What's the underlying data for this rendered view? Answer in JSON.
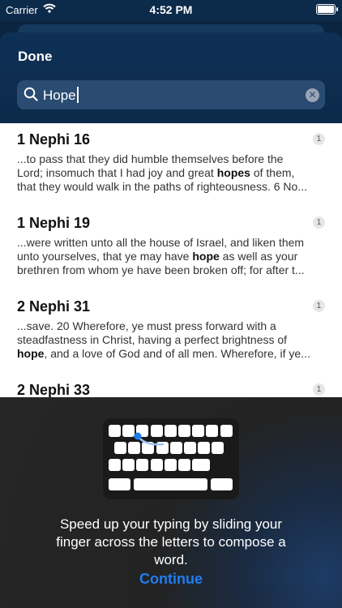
{
  "status_bar": {
    "carrier": "Carrier",
    "time": "4:52 PM"
  },
  "header": {
    "done_label": "Done"
  },
  "search": {
    "value": "Hope"
  },
  "results": [
    {
      "title": "1 Nephi 16",
      "count": "1",
      "lines": [
        [
          {
            "t": "...to pass that they did humble themselves before the"
          }
        ],
        [
          {
            "t": "Lord; insomuch that I had joy and great "
          },
          {
            "t": "hopes",
            "b": true
          },
          {
            "t": " of them,"
          }
        ],
        [
          {
            "t": "that they would walk in the paths of righteousness. 6 No..."
          }
        ]
      ]
    },
    {
      "title": "1 Nephi 19",
      "count": "1",
      "lines": [
        [
          {
            "t": "...were written unto all the house of Israel, and liken them"
          }
        ],
        [
          {
            "t": "unto yourselves, that ye may have "
          },
          {
            "t": "hope",
            "b": true
          },
          {
            "t": " as well as your"
          }
        ],
        [
          {
            "t": "brethren from whom ye have been broken off; for after t..."
          }
        ]
      ]
    },
    {
      "title": "2 Nephi 31",
      "count": "1",
      "lines": [
        [
          {
            "t": "...save. 20 Wherefore, ye must press forward with a"
          }
        ],
        [
          {
            "t": "steadfastness in Christ, having a perfect brightness of"
          }
        ],
        [
          {
            "t": "hope",
            "b": true
          },
          {
            "t": ", and a love of God and of all men. Wherefore, if ye..."
          }
        ]
      ]
    },
    {
      "title": "2 Nephi 33",
      "count": "1",
      "lines": []
    }
  ],
  "overlay": {
    "tip_line1": "Speed up your typing by sliding your",
    "tip_line2": "finger across the letters to compose a",
    "tip_line3": "word.",
    "continue_label": "Continue"
  },
  "colors": {
    "accent": "#1e7ef0",
    "header_bg": "#0d2c4f",
    "overlay_bg": "#262626"
  }
}
